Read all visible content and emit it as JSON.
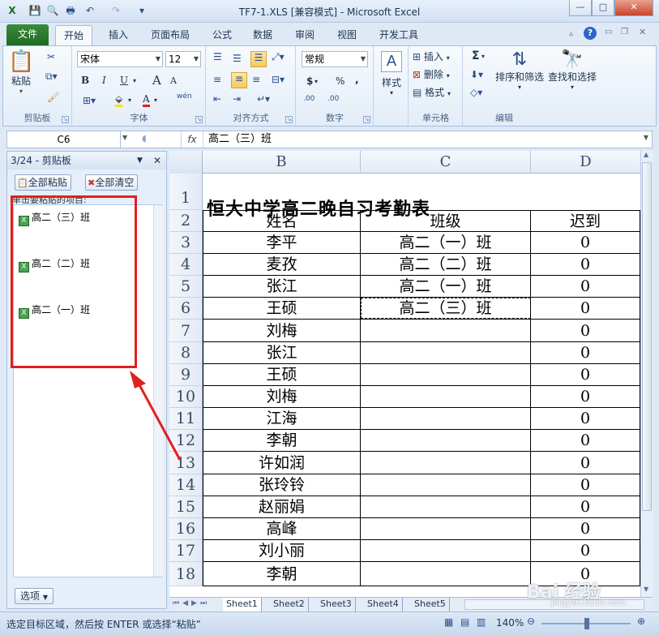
{
  "window": {
    "title": "TF7-1.XLS  [兼容模式] - Microsoft Excel",
    "min": "—",
    "restore": "□",
    "close": "✕",
    "help": "?"
  },
  "ribbon_tabs": [
    "文件",
    "开始",
    "插入",
    "页面布局",
    "公式",
    "数据",
    "审阅",
    "视图",
    "开发工具"
  ],
  "ribbon": {
    "clipboard": {
      "label": "剪贴板",
      "paste": "粘贴"
    },
    "font": {
      "label": "字体",
      "name": "宋体",
      "size": "12",
      "bold": "B",
      "italic": "I",
      "underline": "U",
      "grow": "A",
      "shrink": "A",
      "wen": "wén"
    },
    "alignment": {
      "label": "对齐方式"
    },
    "number": {
      "label": "数字",
      "format": "常规",
      "currency": "$",
      "percent": "%",
      "comma": ",",
      "inc": ".00",
      "dec": ".00"
    },
    "styles": {
      "label": "样式"
    },
    "cells": {
      "label": "单元格",
      "insert": "插入",
      "delete": "删除",
      "format": "格式"
    },
    "editing": {
      "label": "编辑",
      "sigma": "Σ",
      "sort": "排序和筛选",
      "find": "查找和选择"
    }
  },
  "formula_bar": {
    "name_box": "C6",
    "fx": "fx",
    "content": "高二（三）班"
  },
  "clipboard_pane": {
    "header": "3/24 - 剪贴板",
    "paste_all": "全部粘贴",
    "clear_all": "全部清空",
    "hint": "单击要粘贴的项目:",
    "items": [
      "高二（三）班",
      "高二（二）班",
      "高二（一）班"
    ],
    "options": "选项"
  },
  "sheet": {
    "columns": [
      "B",
      "C",
      "D"
    ],
    "rows": [
      "1",
      "2",
      "3",
      "4",
      "5",
      "6",
      "7",
      "8",
      "9",
      "10",
      "11",
      "12",
      "13",
      "14",
      "15",
      "16",
      "17",
      "18"
    ],
    "title": "恒大中学高二晚自习考勤表",
    "headers": [
      "姓名",
      "班级",
      "迟到"
    ],
    "names": [
      "李平",
      "麦孜",
      "张江",
      "王硕",
      "刘梅",
      "张江",
      "王硕",
      "刘梅",
      "江海",
      "李朝",
      "许如润",
      "张玲铃",
      "赵丽娟",
      "高峰",
      "刘小丽",
      "李朝"
    ],
    "classes": [
      "高二（一）班",
      "高二（二）班",
      "高二（一）班",
      "高二（三）班",
      "",
      "",
      "",
      "",
      "",
      "",
      "",
      "",
      "",
      "",
      "",
      ""
    ],
    "late": [
      "0",
      "0",
      "0",
      "0",
      "0",
      "0",
      "0",
      "0",
      "0",
      "0",
      "0",
      "0",
      "0",
      "0",
      "0",
      "0"
    ]
  },
  "sheet_tabs": [
    "Sheet1",
    "Sheet2",
    "Sheet3",
    "Sheet4",
    "Sheet5"
  ],
  "status": {
    "text": "选定目标区域，然后按 ENTER 或选择“粘贴”",
    "zoom": "140%"
  },
  "watermark": {
    "brand": "Bai 经验",
    "url": "jingyan.baidu.com"
  }
}
